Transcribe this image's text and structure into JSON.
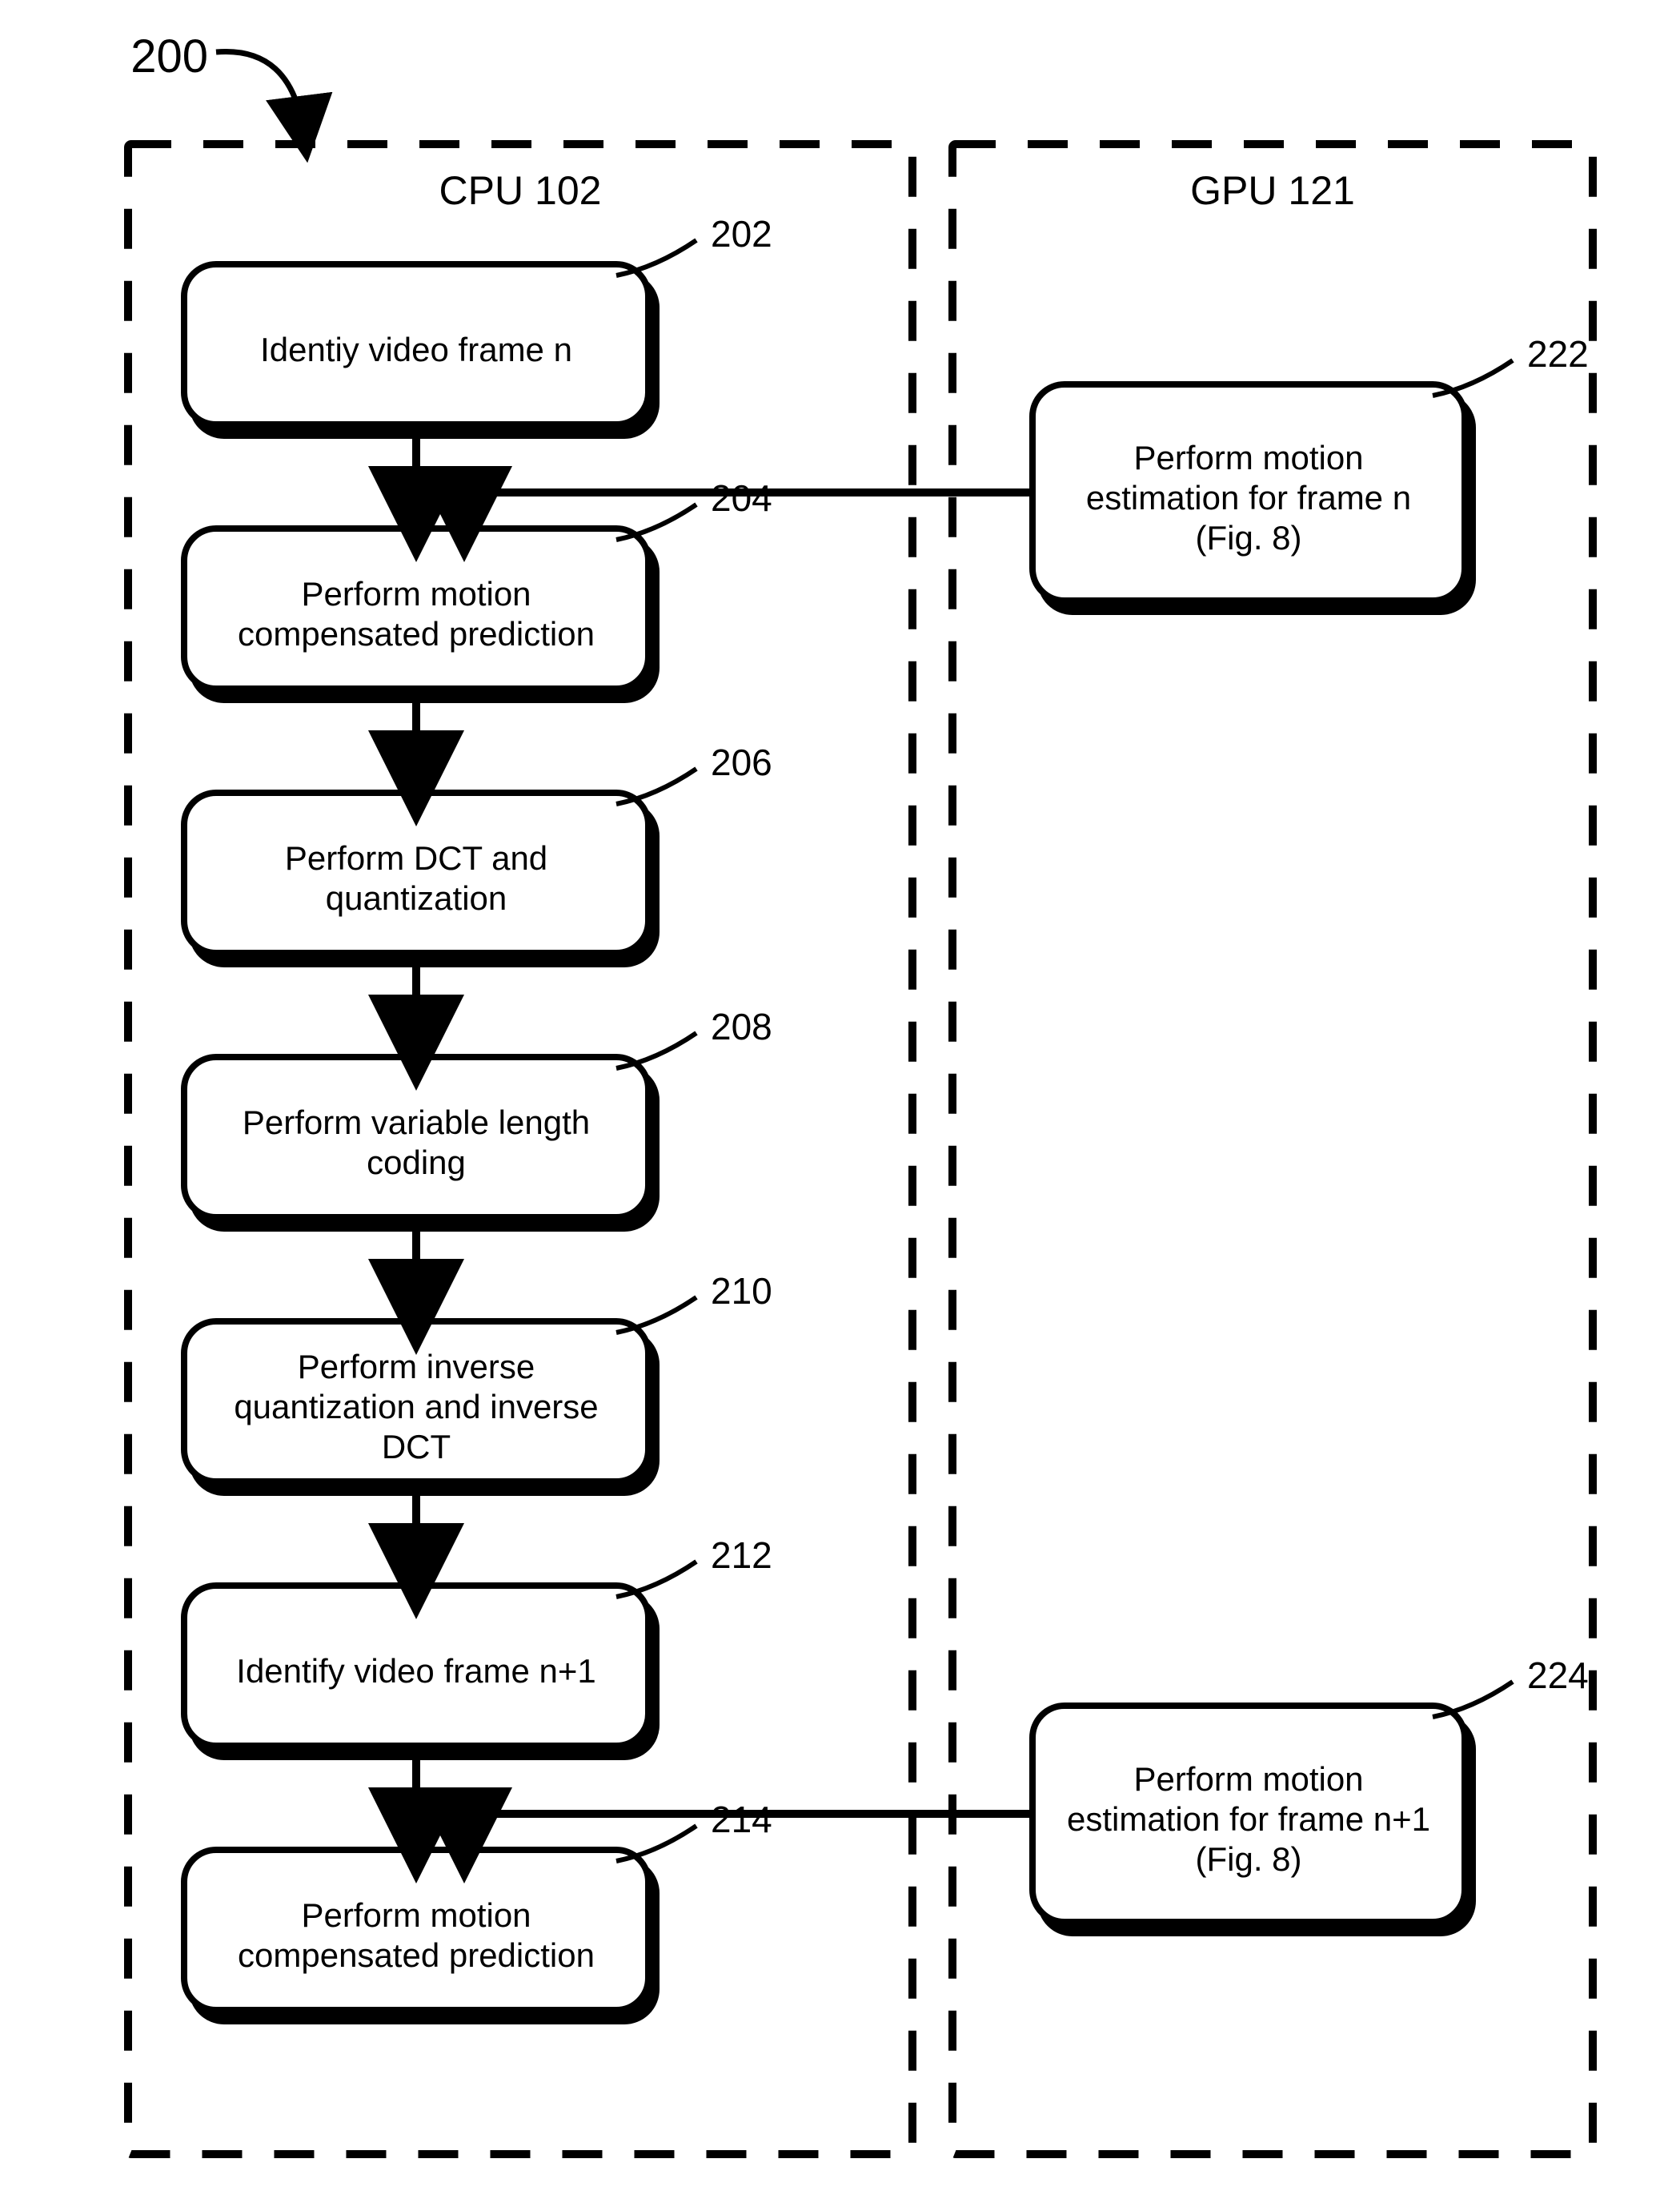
{
  "figure_ref": "200",
  "cpu_title": "CPU 102",
  "gpu_title": "GPU 121",
  "cpu_steps": [
    {
      "ref": "202",
      "lines": [
        "Identiy video frame n"
      ]
    },
    {
      "ref": "204",
      "lines": [
        "Perform motion",
        "compensated prediction"
      ]
    },
    {
      "ref": "206",
      "lines": [
        "Perform DCT and",
        "quantization"
      ]
    },
    {
      "ref": "208",
      "lines": [
        "Perform variable length",
        "coding"
      ]
    },
    {
      "ref": "210",
      "lines": [
        "Perform inverse",
        "quantization and inverse",
        "DCT"
      ]
    },
    {
      "ref": "212",
      "lines": [
        "Identify video frame n+1"
      ]
    },
    {
      "ref": "214",
      "lines": [
        "Perform motion",
        "compensated prediction"
      ]
    }
  ],
  "gpu_steps": [
    {
      "ref": "222",
      "lines": [
        "Perform motion",
        "estimation for frame n",
        "(Fig. 8)"
      ]
    },
    {
      "ref": "224",
      "lines": [
        "Perform motion",
        "estimation for frame n+1",
        "(Fig. 8)"
      ]
    }
  ]
}
